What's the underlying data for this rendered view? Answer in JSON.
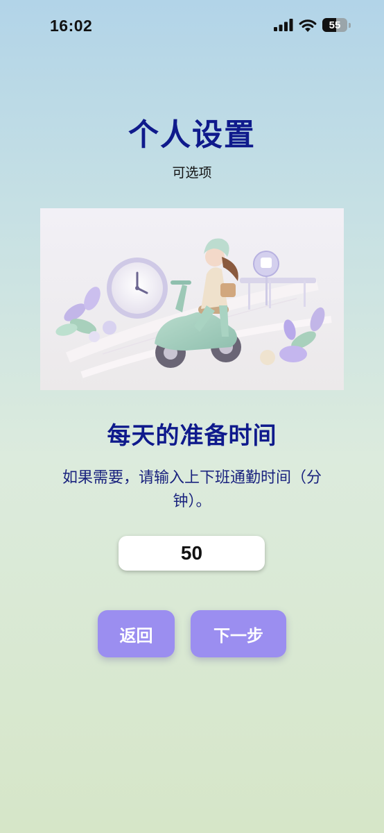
{
  "status_bar": {
    "time": "16:02",
    "battery_level": "55",
    "icons": [
      "signal-icon",
      "wifi-icon",
      "battery-icon"
    ]
  },
  "header": {
    "title": "个人设置",
    "subtitle": "可选项"
  },
  "illustration": {
    "icon": "scooter-commute-illustration"
  },
  "section": {
    "title": "每天的准备时间",
    "description": "如果需要，请输入上下班通勤时间（分钟）。"
  },
  "minutes_input": {
    "value": "50"
  },
  "buttons": {
    "back_label": "返回",
    "next_label": "下一步"
  },
  "colors": {
    "title": "#0f1a8c",
    "button": "#9b8ef0"
  }
}
